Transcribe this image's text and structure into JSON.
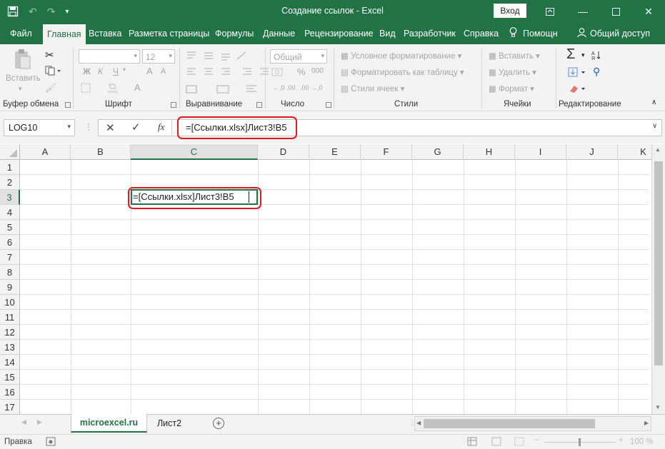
{
  "window": {
    "title": "Создание ссылок  -  Excel",
    "signin_label": "Вход",
    "accent_color": "#217346"
  },
  "tabs": [
    "Файл",
    "Главная",
    "Вставка",
    "Разметка страницы",
    "Формулы",
    "Данные",
    "Рецензирование",
    "Вид",
    "Разработчик",
    "Справка",
    "Помощн",
    "Общий доступ"
  ],
  "ribbon": {
    "clipboard": {
      "paste_label": "Вставить",
      "group_label": "Буфер обмена"
    },
    "font": {
      "font_name": "",
      "font_size": "12",
      "bold": "Ж",
      "italic": "К",
      "underline": "Ч",
      "grow": "A",
      "shrink": "A",
      "group_label": "Шрифт"
    },
    "alignment": {
      "group_label": "Выравнивание"
    },
    "number": {
      "format": "Общий",
      "percent": "%",
      "thousands": "000",
      "group_label": "Число"
    },
    "styles": {
      "conditional": "Условное форматирование",
      "format_table": "Форматировать как таблицу",
      "cell_styles": "Стили ячеек",
      "group_label": "Стили"
    },
    "cells": {
      "insert": "Вставить",
      "delete": "Удалить",
      "format": "Формат",
      "group_label": "Ячейки"
    },
    "editing": {
      "group_label": "Редактирование"
    }
  },
  "formula_bar": {
    "name_box": "LOG10",
    "fx": "fx",
    "formula": "=[Ссылки.xlsx]Лист3!B5"
  },
  "grid": {
    "columns": [
      "A",
      "B",
      "C",
      "D",
      "E",
      "F",
      "G",
      "H",
      "I",
      "J",
      "K"
    ],
    "rows": [
      "1",
      "2",
      "3",
      "4",
      "5",
      "6",
      "7",
      "8",
      "9",
      "10",
      "11",
      "12",
      "13",
      "14",
      "15",
      "16",
      "17"
    ],
    "active_cell": "C3",
    "active_cell_text": "=[Ссылки.xlsx]Лист3!B5"
  },
  "sheets": [
    "microexcel.ru",
    "Лист2"
  ],
  "status": {
    "mode": "Правка",
    "zoom": "100 %"
  }
}
